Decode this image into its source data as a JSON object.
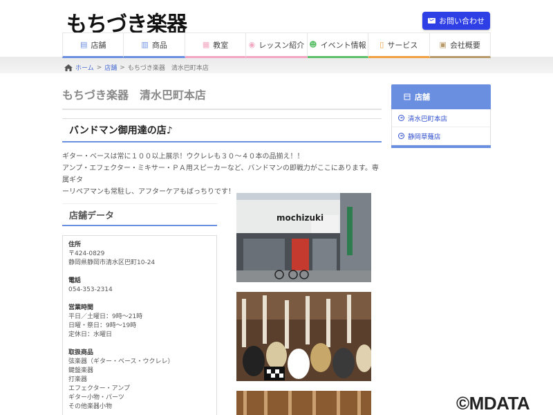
{
  "header": {
    "logo_text": "もちづき楽器",
    "contact_label": "お問い合わせ"
  },
  "nav": {
    "items": [
      {
        "label": "店舗",
        "icon": "store-icon",
        "color": "#6b8fe0"
      },
      {
        "label": "商品",
        "icon": "barcode-icon",
        "color": "#6b8fe0"
      },
      {
        "label": "教室",
        "icon": "calendar-icon",
        "color": "#f3a6c1"
      },
      {
        "label": "レッスン紹介",
        "icon": "chat-icon",
        "color": "#f3a6c1"
      },
      {
        "label": "イベント情報",
        "icon": "group-icon",
        "color": "#5cbf6a"
      },
      {
        "label": "サービス",
        "icon": "document-icon",
        "color": "#f0a040"
      },
      {
        "label": "会社概要",
        "icon": "building-icon",
        "color": "#b89a6a"
      }
    ]
  },
  "breadcrumb": {
    "home": "ホーム",
    "sep": ">",
    "level1": "店舗",
    "current": "もちづき楽器　清水巴町本店"
  },
  "main": {
    "page_title": "もちづき楽器　清水巴町本店",
    "section_heading": "バンドマン御用達の店♪",
    "intro_lines": [
      "ギター・ベースは常に１００以上展示！ウクレレも３０～４０本の品揃え！！",
      "アンプ・エフェクター・ミキサー・ＰＡ用スピーカーなど、バンドマンの即戦力がここにあります。専属ギタ",
      "ーリペアマンも常駐し、アフターケアもばっちりです！"
    ],
    "data_heading": "店舗データ",
    "data": {
      "address_label": "住所",
      "postal": "〒424-0829",
      "address": "静岡県静岡市清水区巴町10-24",
      "phone_label": "電話",
      "phone": "054-353-2314",
      "hours_label": "営業時間",
      "hours_weekday": "平日／土曜日：9時～21時",
      "hours_holiday": "日曜・祭日：9時～19時",
      "closed": "定休日：水曜日",
      "products_label": "取扱商品",
      "products": [
        "弦楽器（ギター・ベース・ウクレレ）",
        "鍵盤楽器",
        "打楽器",
        "エフェクター・アンプ",
        "ギター小物・パーツ",
        "その他楽器小物"
      ]
    },
    "photo_sign": "mochizuki"
  },
  "sidebar": {
    "heading": "店舗",
    "items": [
      {
        "label": "清水巴町本店"
      },
      {
        "label": "静岡草薙店"
      }
    ]
  },
  "watermark": "©MDATA"
}
